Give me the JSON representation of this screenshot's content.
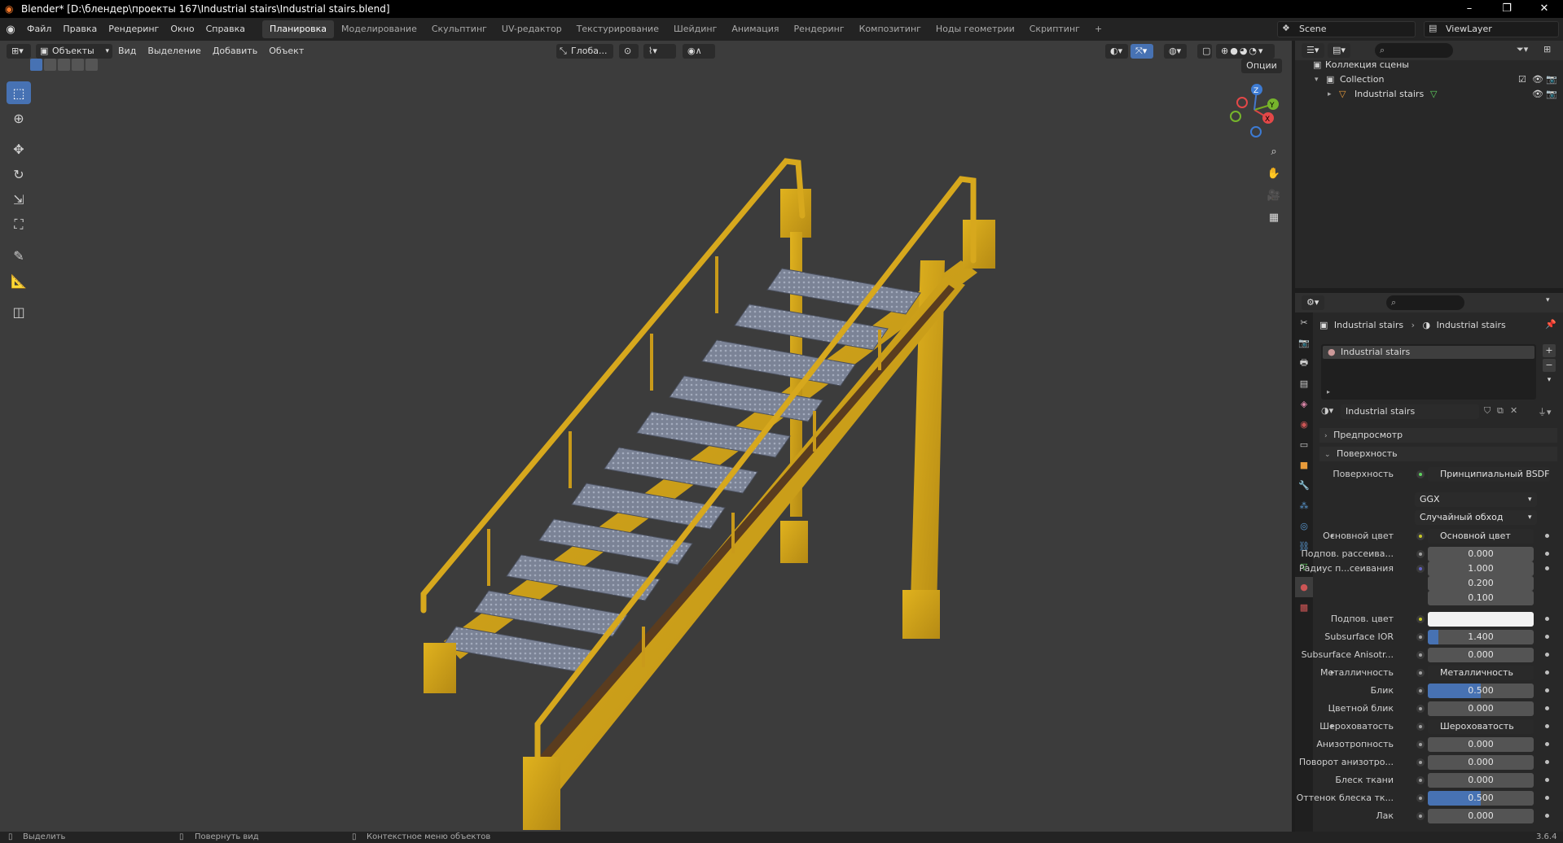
{
  "window": {
    "title": "Blender* [D:\\блендер\\проекты 167\\Industrial stairs\\Industrial stairs.blend]",
    "minimize": "–",
    "maximize": "❐",
    "close": "✕"
  },
  "menus": [
    "Файл",
    "Правка",
    "Рендеринг",
    "Окно",
    "Справка"
  ],
  "workspaces": [
    "Планировка",
    "Моделирование",
    "Скульптинг",
    "UV-редактор",
    "Текстурирование",
    "Шейдинг",
    "Анимация",
    "Рендеринг",
    "Композитинг",
    "Ноды геометрии",
    "Скриптинг",
    "+"
  ],
  "scene": {
    "name": "Scene",
    "view_layer": "ViewLayer"
  },
  "viewport": {
    "mode": "Объекты",
    "menu": [
      "Вид",
      "Выделение",
      "Добавить",
      "Объект"
    ],
    "orientation": "Глоба...",
    "options": "Опции",
    "gizmo_axes": [
      "X",
      "Y",
      "Z"
    ]
  },
  "outliner": {
    "scene_collection": "Коллекция сцены",
    "collection": "Collection",
    "object": "Industrial stairs"
  },
  "properties": {
    "breadcrumb": [
      "Industrial stairs",
      "Industrial stairs"
    ],
    "slot": "Industrial stairs",
    "material_name": "Industrial stairs",
    "panels": {
      "preview": "Предпросмотр",
      "surface": "Поверхность"
    },
    "surface_label": "Поверхность",
    "surface_value": "Принципиальный BSDF",
    "distribution": "GGX",
    "subsurface_method": "Случайный обход",
    "rows": [
      {
        "label": "Основной цвет",
        "value": "Основной цвет",
        "kind": "link",
        "dot": "#c7c729",
        "expand": true
      },
      {
        "label": "Подпов. рассеива...",
        "value": "0.000",
        "kind": "num",
        "dot": "#a1a1a1"
      },
      {
        "label": "Радиус п...сеивания",
        "value": "1.000",
        "kind": "vec",
        "dot": "#6363c7"
      },
      {
        "label": "",
        "value": "0.200",
        "kind": "vec2"
      },
      {
        "label": "",
        "value": "0.100",
        "kind": "vec2"
      },
      {
        "label": "Подпов. цвет",
        "value": "",
        "kind": "color",
        "dot": "#c7c729"
      },
      {
        "label": "Subsurface IOR",
        "value": "1.400",
        "kind": "num",
        "dot": "#a1a1a1",
        "fill": 0.1
      },
      {
        "label": "Subsurface Anisotr...",
        "value": "0.000",
        "kind": "num",
        "dot": "#a1a1a1"
      },
      {
        "label": "Металличность",
        "value": "Металличность",
        "kind": "link",
        "dot": "#a1a1a1",
        "expand": true
      },
      {
        "label": "Блик",
        "value": "0.500",
        "kind": "num",
        "dot": "#a1a1a1",
        "fill": 0.5
      },
      {
        "label": "Цветной блик",
        "value": "0.000",
        "kind": "num",
        "dot": "#a1a1a1"
      },
      {
        "label": "Шероховатость",
        "value": "Шероховатость",
        "kind": "link",
        "dot": "#a1a1a1",
        "expand": true
      },
      {
        "label": "Анизотропность",
        "value": "0.000",
        "kind": "num",
        "dot": "#a1a1a1"
      },
      {
        "label": "Поворот анизотро...",
        "value": "0.000",
        "kind": "num",
        "dot": "#a1a1a1"
      },
      {
        "label": "Блеск ткани",
        "value": "0.000",
        "kind": "num",
        "dot": "#a1a1a1"
      },
      {
        "label": "Оттенок блеска тк...",
        "value": "0.500",
        "kind": "num",
        "dot": "#a1a1a1",
        "fill": 0.5
      },
      {
        "label": "Лак",
        "value": "0.000",
        "kind": "num",
        "dot": "#a1a1a1"
      }
    ]
  },
  "statusbar": {
    "select": "Выделить",
    "rotate": "Повернуть вид",
    "context": "Контекстное меню объектов",
    "version": "3.6.4"
  },
  "colors": {
    "accent": "#4772b3",
    "stair_yellow": "#d9a91c",
    "rust": "#5a3c1f",
    "tread": "#7d8597"
  }
}
